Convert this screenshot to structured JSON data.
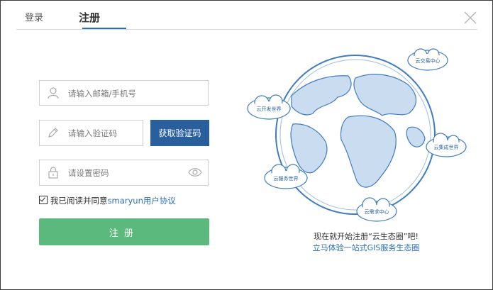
{
  "tabs": {
    "login": "登录",
    "register": "注册"
  },
  "form": {
    "account_placeholder": "请输入邮箱/手机号",
    "code_placeholder": "请输入验证码",
    "get_code_label": "获取验证码",
    "password_placeholder": "请设置密码",
    "agree_prefix": "我已阅读并同意",
    "agree_link": "smaryun用户协议",
    "agree_checked": true,
    "submit_label": "注册"
  },
  "illustration": {
    "clouds": [
      "云交易中心",
      "云开发世界",
      "云集成世界",
      "云服务世界",
      "云需求中心"
    ]
  },
  "promo": {
    "line1": "现在就开始注册“云生态圈”吧!",
    "line2": "立马体验一站式GIS服务生态圈"
  },
  "colors": {
    "primary": "#2a5f9e",
    "accent_green": "#5cb97d",
    "link": "#2a6fb5"
  }
}
